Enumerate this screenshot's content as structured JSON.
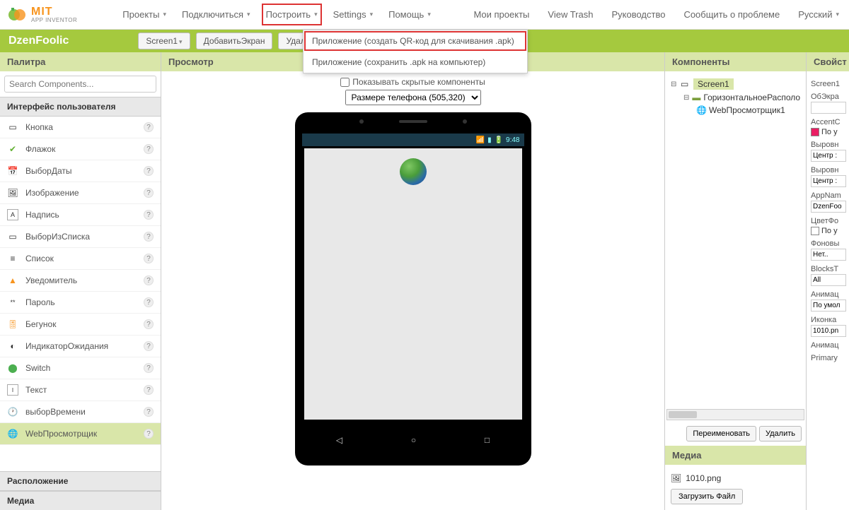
{
  "logo": {
    "mit": "MIT",
    "sub": "APP INVENTOR"
  },
  "topnav": {
    "projects": "Проекты",
    "connect": "Подключиться",
    "build": "Построить",
    "settings": "Settings",
    "help": "Помощь",
    "my_projects": "Мои проекты",
    "view_trash": "View Trash",
    "guide": "Руководство",
    "report": "Сообщить о проблеме",
    "lang": "Русский"
  },
  "dropdown": {
    "item1": "Приложение (создать QR-код для скачивания .apk)",
    "item2": "Приложение (сохранить .apk на компьютер)"
  },
  "greenbar": {
    "project": "DzenFoolic",
    "screen": "Screen1",
    "add": "ДобавитьЭкран",
    "remove": "Удал"
  },
  "palette": {
    "header": "Палитра",
    "search_placeholder": "Search Components...",
    "cat_ui": "Интерфейс пользователя",
    "items": [
      "Кнопка",
      "Флажок",
      "ВыборДаты",
      "Изображение",
      "Надпись",
      "ВыборИзСписка",
      "Список",
      "Уведомитель",
      "Пароль",
      "Бегунок",
      "ИндикаторОжидания",
      "Switch",
      "Текст",
      "выборВремени",
      "WebПросмотрщик"
    ],
    "cat_layout": "Расположение",
    "cat_media": "Медиа"
  },
  "viewer": {
    "header": "Просмотр",
    "hidden_label": "Показывать скрытые компоненты",
    "size_label": "Размере телефона (505,320)",
    "time": "9:48"
  },
  "components": {
    "header": "Компоненты",
    "screen": "Screen1",
    "horiz": "ГоризонтальноеРасполо",
    "web": "WebПросмотрщик1",
    "rename": "Переименовать",
    "delete": "Удалить"
  },
  "media": {
    "header": "Медиа",
    "file": "1010.png",
    "upload": "Загрузить Файл"
  },
  "props": {
    "header": "Свойст",
    "screen": "Screen1",
    "about": "ОбЭкра",
    "accent": "AccentC",
    "accent_val": "По у",
    "align_h": "Выровн",
    "align_h_val": "Центр :",
    "align_v": "Выровн",
    "align_v_val": "Центр :",
    "appname": "AppNam",
    "appname_val": "DzenFoo",
    "bgcolor": "ЦветФо",
    "bgcolor_val": "По у",
    "bgimage": "Фоновы",
    "bgimage_val": "Нет..",
    "blocks": "BlocksT",
    "blocks_val": "All",
    "anim_close": "Анимац",
    "anim_close_val": "По умол",
    "icon": "Иконка",
    "icon_val": "1010.pn",
    "anim_open": "Анимац",
    "primary": "Primary"
  }
}
